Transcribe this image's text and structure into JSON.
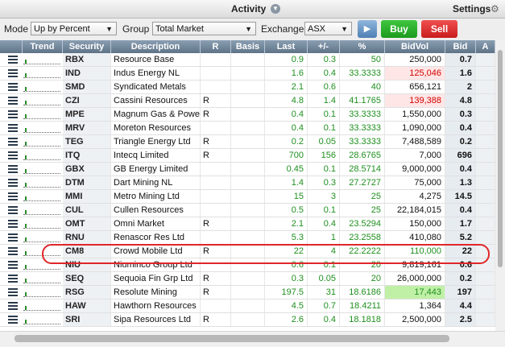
{
  "titlebar": {
    "title": "Activity",
    "settings_label": "Settings"
  },
  "toolbar": {
    "mode_label": "Mode",
    "mode_value": "Up by Percent",
    "group_label": "Group",
    "group_value": "Total Market",
    "exchange_label": "Exchange",
    "exchange_value": "ASX",
    "play_label": "▶",
    "buy_label": "Buy",
    "sell_label": "Sell"
  },
  "columns": [
    "Trend",
    "Security",
    "Description",
    "R",
    "Basis",
    "Last",
    "+/-",
    "%",
    "BidVol",
    "Bid",
    "A"
  ],
  "rows": [
    {
      "code": "RBX",
      "desc": "Resource Base",
      "r": "",
      "last": "0.9",
      "chg": "0.3",
      "pct": "50",
      "bidvol": "250,000",
      "bid": "0.7"
    },
    {
      "code": "IND",
      "desc": "Indus Energy NL",
      "r": "",
      "last": "1.6",
      "chg": "0.4",
      "pct": "33.3333",
      "bidvol": "125,046",
      "bid": "1.6",
      "bidvol_red": true
    },
    {
      "code": "SMD",
      "desc": "Syndicated Metals",
      "r": "",
      "last": "2.1",
      "chg": "0.6",
      "pct": "40",
      "bidvol": "656,121",
      "bid": "2"
    },
    {
      "code": "CZI",
      "desc": "Cassini Resources",
      "r": "R",
      "last": "4.8",
      "chg": "1.4",
      "pct": "41.1765",
      "bidvol": "139,388",
      "bid": "4.8",
      "bidvol_red": true
    },
    {
      "code": "MPE",
      "desc": "Magnum Gas & Powe",
      "r": "R",
      "last": "0.4",
      "chg": "0.1",
      "pct": "33.3333",
      "bidvol": "1,550,000",
      "bid": "0.3"
    },
    {
      "code": "MRV",
      "desc": "Moreton Resources",
      "r": "",
      "last": "0.4",
      "chg": "0.1",
      "pct": "33.3333",
      "bidvol": "1,090,000",
      "bid": "0.4"
    },
    {
      "code": "TEG",
      "desc": "Triangle Energy Ltd",
      "r": "R",
      "last": "0.2",
      "chg": "0.05",
      "pct": "33.3333",
      "bidvol": "7,488,589",
      "bid": "0.2"
    },
    {
      "code": "ITQ",
      "desc": "Intecq Limited",
      "r": "R",
      "last": "700",
      "chg": "156",
      "pct": "28.6765",
      "bidvol": "7,000",
      "bid": "696"
    },
    {
      "code": "GBX",
      "desc": "GB Energy Limited",
      "r": "",
      "last": "0.45",
      "chg": "0.1",
      "pct": "28.5714",
      "bidvol": "9,000,000",
      "bid": "0.4"
    },
    {
      "code": "DTM",
      "desc": "Dart Mining NL",
      "r": "",
      "last": "1.4",
      "chg": "0.3",
      "pct": "27.2727",
      "bidvol": "75,000",
      "bid": "1.3"
    },
    {
      "code": "MMI",
      "desc": "Metro Mining Ltd",
      "r": "",
      "last": "15",
      "chg": "3",
      "pct": "25",
      "bidvol": "4,275",
      "bid": "14.5"
    },
    {
      "code": "CUL",
      "desc": "Cullen Resources",
      "r": "",
      "last": "0.5",
      "chg": "0.1",
      "pct": "25",
      "bidvol": "22,184,015",
      "bid": "0.4"
    },
    {
      "code": "OMT",
      "desc": "Omni Market",
      "r": "R",
      "last": "2.1",
      "chg": "0.4",
      "pct": "23.5294",
      "bidvol": "150,000",
      "bid": "1.7"
    },
    {
      "code": "RNU",
      "desc": "Renascor Res Ltd",
      "r": "",
      "last": "5.3",
      "chg": "1",
      "pct": "23.2558",
      "bidvol": "410,080",
      "bid": "5.2"
    },
    {
      "code": "CM8",
      "desc": "Crowd Mobile Ltd",
      "r": "R",
      "last": "22",
      "chg": "4",
      "pct": "22.2222",
      "bidvol": "110,000",
      "bid": "22",
      "highlight": true
    },
    {
      "code": "NIU",
      "desc": "Niuminco Group Ltd",
      "r": "",
      "last": "0.6",
      "chg": "0.1",
      "pct": "20",
      "bidvol": "9,819,161",
      "bid": "0.6"
    },
    {
      "code": "SEQ",
      "desc": "Sequoia Fin Grp Ltd",
      "r": "R",
      "last": "0.3",
      "chg": "0.05",
      "pct": "20",
      "bidvol": "26,000,000",
      "bid": "0.2"
    },
    {
      "code": "RSG",
      "desc": "Resolute Mining",
      "r": "R",
      "last": "197.5",
      "chg": "31",
      "pct": "18.6186",
      "bidvol": "17,443",
      "bid": "197",
      "bidvol_green": true
    },
    {
      "code": "HAW",
      "desc": "Hawthorn Resources",
      "r": "",
      "last": "4.5",
      "chg": "0.7",
      "pct": "18.4211",
      "bidvol": "1,364",
      "bid": "4.4"
    },
    {
      "code": "SRI",
      "desc": "Sipa Resources Ltd",
      "r": "R",
      "last": "2.6",
      "chg": "0.4",
      "pct": "18.1818",
      "bidvol": "2,500,000",
      "bid": "2.5"
    }
  ],
  "icons": {
    "titlebar": "chevron-down-icon",
    "settings": "gear-icon",
    "row_menu": "menu-icon"
  }
}
